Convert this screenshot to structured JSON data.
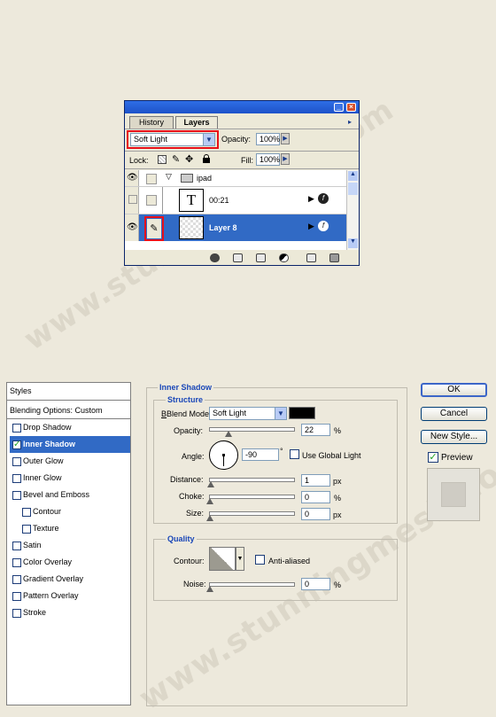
{
  "watermark": "www.stunningmesh.com",
  "layers_panel": {
    "tabs": [
      "History",
      "Layers"
    ],
    "blend_mode": "Soft Light",
    "opacity_label": "Opacity:",
    "opacity_value": "100%",
    "lock_label": "Lock:",
    "fill_label": "Fill:",
    "fill_value": "100%",
    "layers": [
      {
        "name": "ipad",
        "type": "group"
      },
      {
        "name": "00:21",
        "type": "text"
      },
      {
        "name": "Layer 8",
        "type": "layer",
        "selected": true
      }
    ]
  },
  "layer_style": {
    "styles_header": "Styles",
    "blending_options": "Blending Options: Custom",
    "effects": [
      {
        "label": "Drop Shadow",
        "checked": false,
        "sub": false
      },
      {
        "label": "Inner Shadow",
        "checked": true,
        "sub": false,
        "selected": true
      },
      {
        "label": "Outer Glow",
        "checked": false,
        "sub": false
      },
      {
        "label": "Inner Glow",
        "checked": false,
        "sub": false
      },
      {
        "label": "Bevel and Emboss",
        "checked": false,
        "sub": false
      },
      {
        "label": "Contour",
        "checked": false,
        "sub": true
      },
      {
        "label": "Texture",
        "checked": false,
        "sub": true
      },
      {
        "label": "Satin",
        "checked": false,
        "sub": false
      },
      {
        "label": "Color Overlay",
        "checked": false,
        "sub": false
      },
      {
        "label": "Gradient Overlay",
        "checked": false,
        "sub": false
      },
      {
        "label": "Pattern Overlay",
        "checked": false,
        "sub": false
      },
      {
        "label": "Stroke",
        "checked": false,
        "sub": false
      }
    ],
    "section_title": "Inner Shadow",
    "structure_title": "Structure",
    "blend_mode_label": "Blend Mode:",
    "blend_mode_value": "Soft Light",
    "blend_color": "#000000",
    "opacity_label": "Opacity:",
    "opacity_value": "22",
    "angle_label": "Angle:",
    "angle_value": "-90",
    "angle_unit": "°",
    "use_global_light": "Use Global Light",
    "distance_label": "Distance:",
    "distance_value": "1",
    "choke_label": "Choke:",
    "choke_value": "0",
    "size_label": "Size:",
    "size_value": "0",
    "unit_px": "px",
    "unit_pct": "%",
    "quality_title": "Quality",
    "contour_label": "Contour:",
    "anti_aliased": "Anti-aliased",
    "noise_label": "Noise:",
    "noise_value": "0",
    "buttons": {
      "ok": "OK",
      "cancel": "Cancel",
      "new_style": "New Style...",
      "preview": "Preview"
    },
    "preview_checked": true
  }
}
